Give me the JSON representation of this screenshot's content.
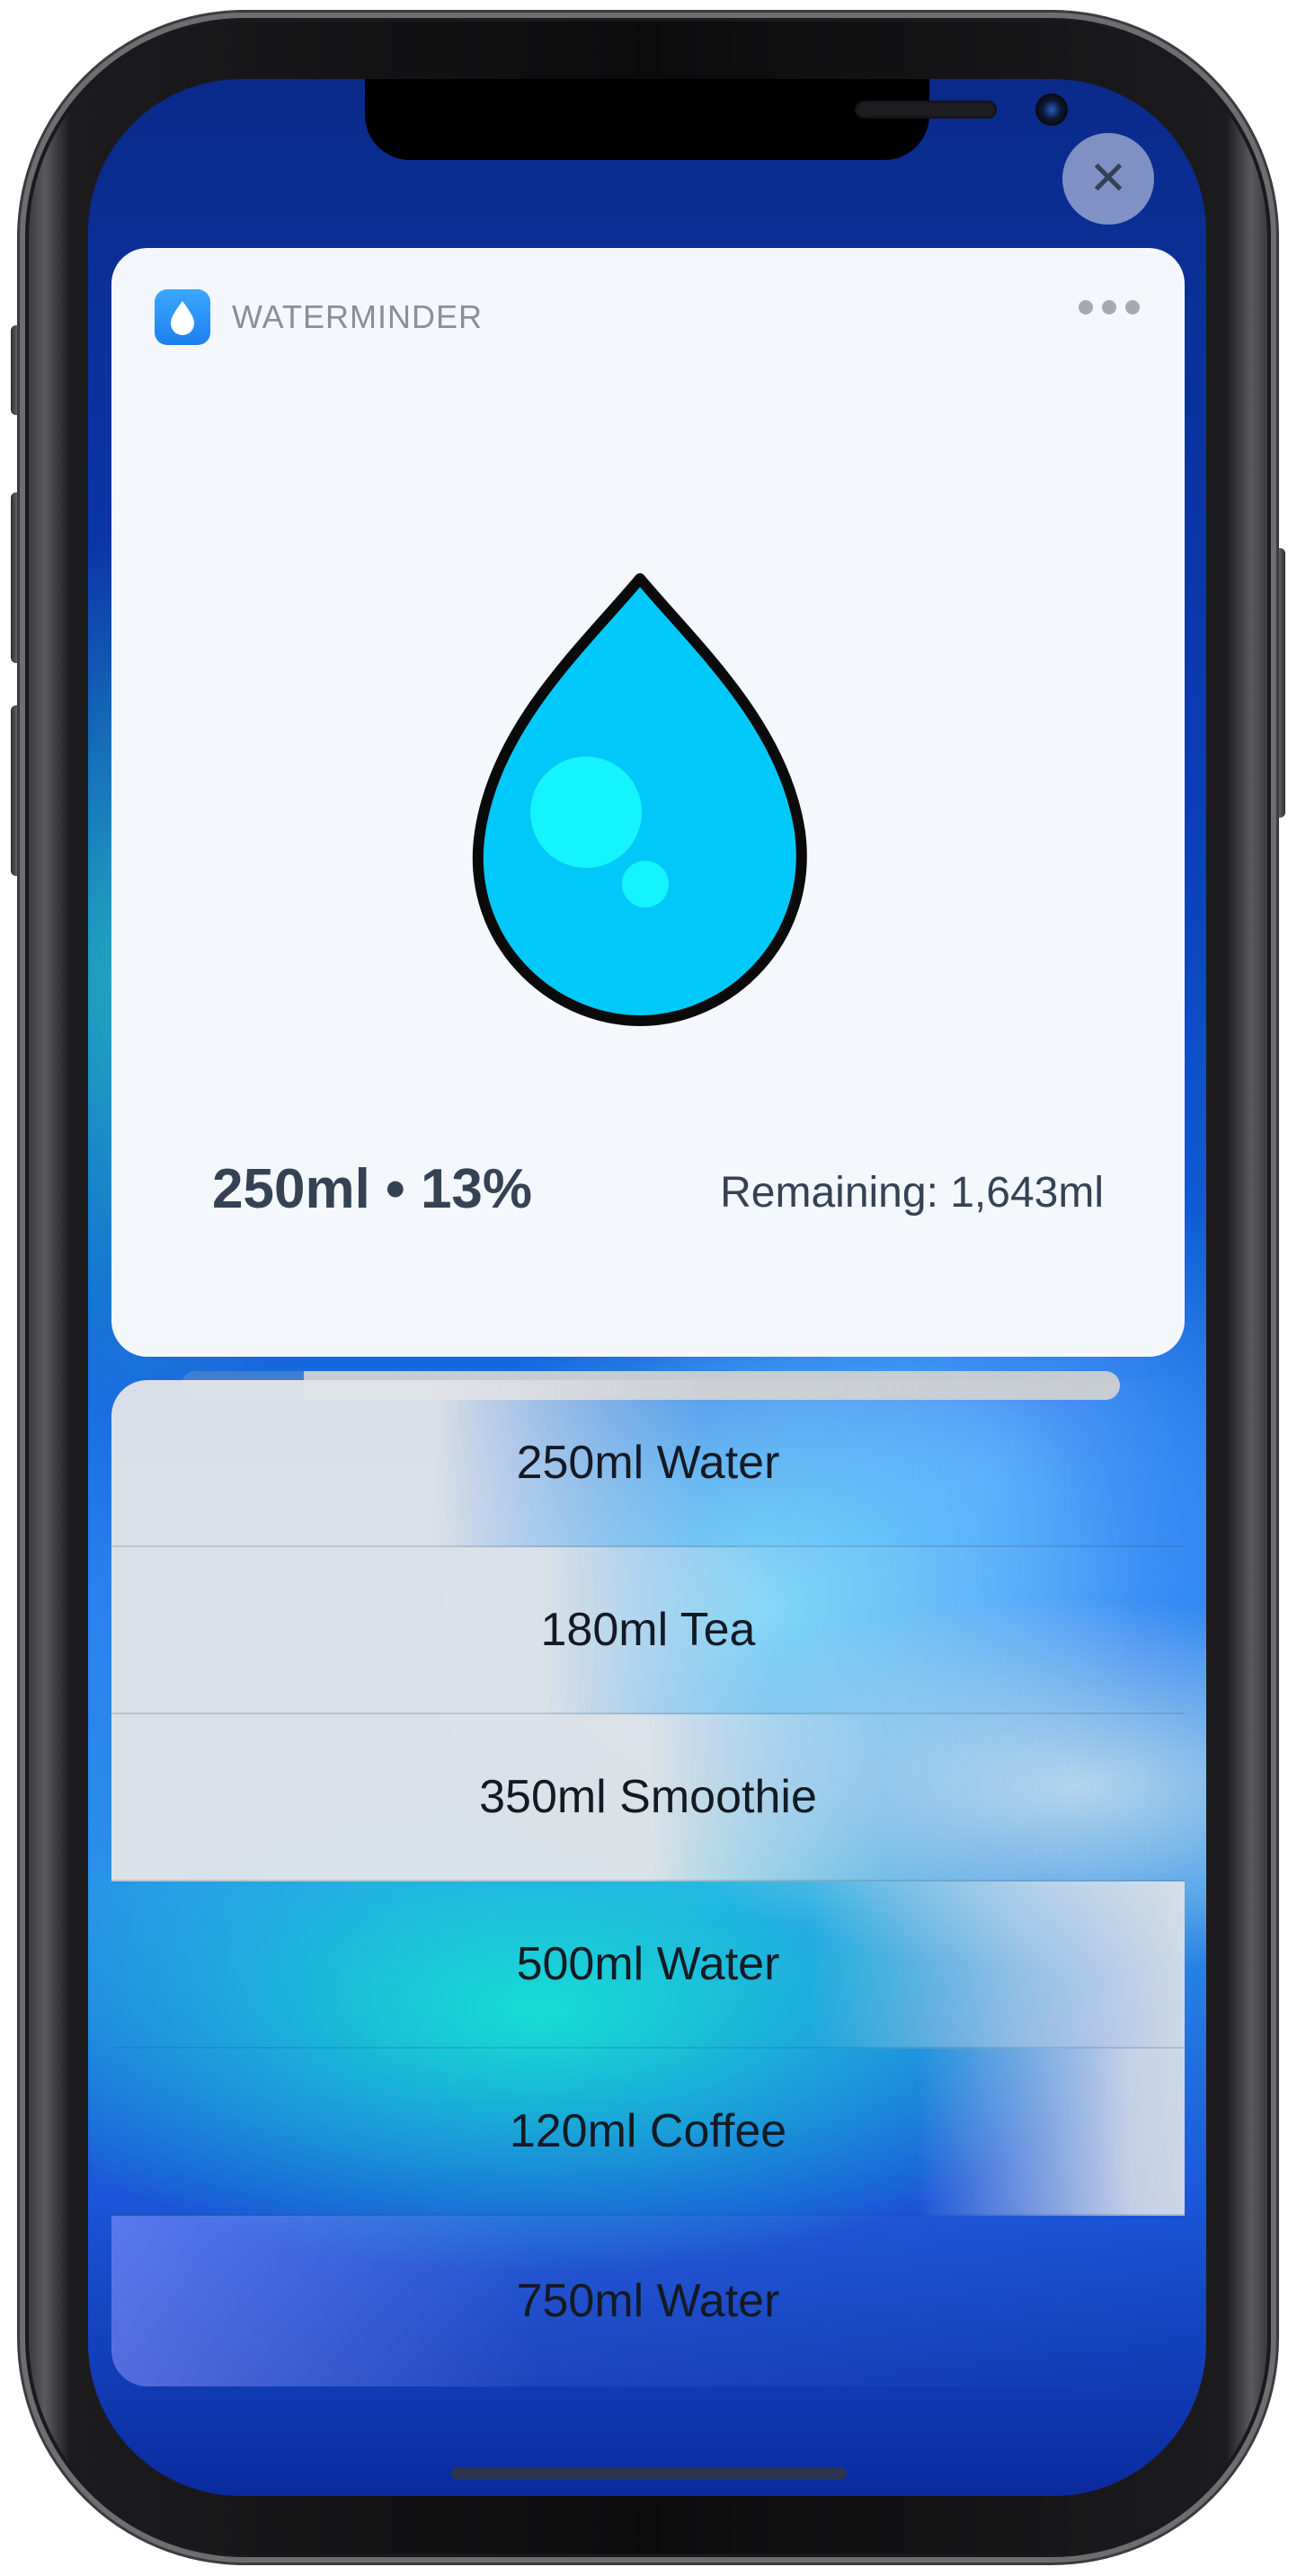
{
  "colors": {
    "card_background": "#f4f7fc",
    "primary_text": "#354254",
    "progress_fill": "#3b7fd2",
    "progress_track": "#c7ccd1",
    "drop_fill": "#00c8f8",
    "drop_highlight": "#14f4ff"
  },
  "icons": {
    "close": "close-icon",
    "app": "water-drop-icon",
    "more": "more-dots-icon",
    "illustration": "water-drop-illustration"
  },
  "widget": {
    "app_name": "WATERMINDER",
    "close_glyph": "✕",
    "intake_text": "250ml • 13%",
    "remaining_text": "Remaining: 1,643ml",
    "progress_fraction": 0.13
  },
  "quick_actions": [
    {
      "label": "250ml Water"
    },
    {
      "label": "180ml Tea"
    },
    {
      "label": "350ml Smoothie"
    },
    {
      "label": "500ml Water"
    },
    {
      "label": "120ml Coffee"
    },
    {
      "label": "750ml Water"
    }
  ]
}
